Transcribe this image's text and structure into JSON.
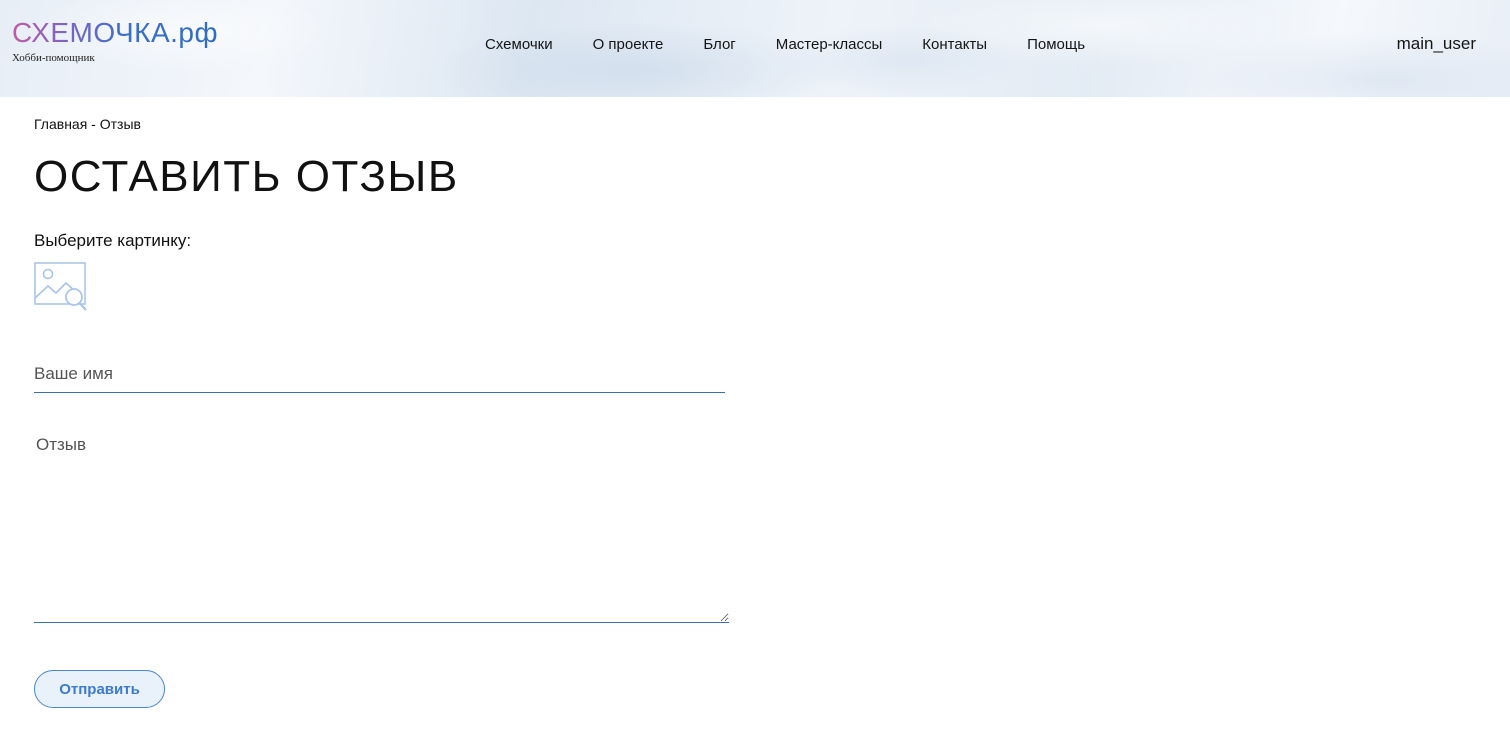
{
  "header": {
    "logo_main": "СХЕМОЧКА.рф",
    "logo_sub": "Хобби-помощник",
    "nav": [
      "Схемочки",
      "О проекте",
      "Блог",
      "Мастер-классы",
      "Контакты",
      "Помощь"
    ],
    "user": "main_user"
  },
  "breadcrumb": {
    "home": "Главная",
    "separator": " - ",
    "current": "Отзыв"
  },
  "page": {
    "title": "ОСТАВИТЬ ОТЗЫВ",
    "pick_label": "Выберите картинку:",
    "pick_icon": "image-search-icon"
  },
  "form": {
    "name_placeholder": "Ваше имя",
    "name_value": "",
    "review_placeholder": "Отзыв",
    "review_value": "",
    "submit_label": "Отправить"
  },
  "colors": {
    "accent": "#3b7bd0",
    "field_border": "#3a6fb8",
    "button_bg": "#e9f1fb"
  }
}
